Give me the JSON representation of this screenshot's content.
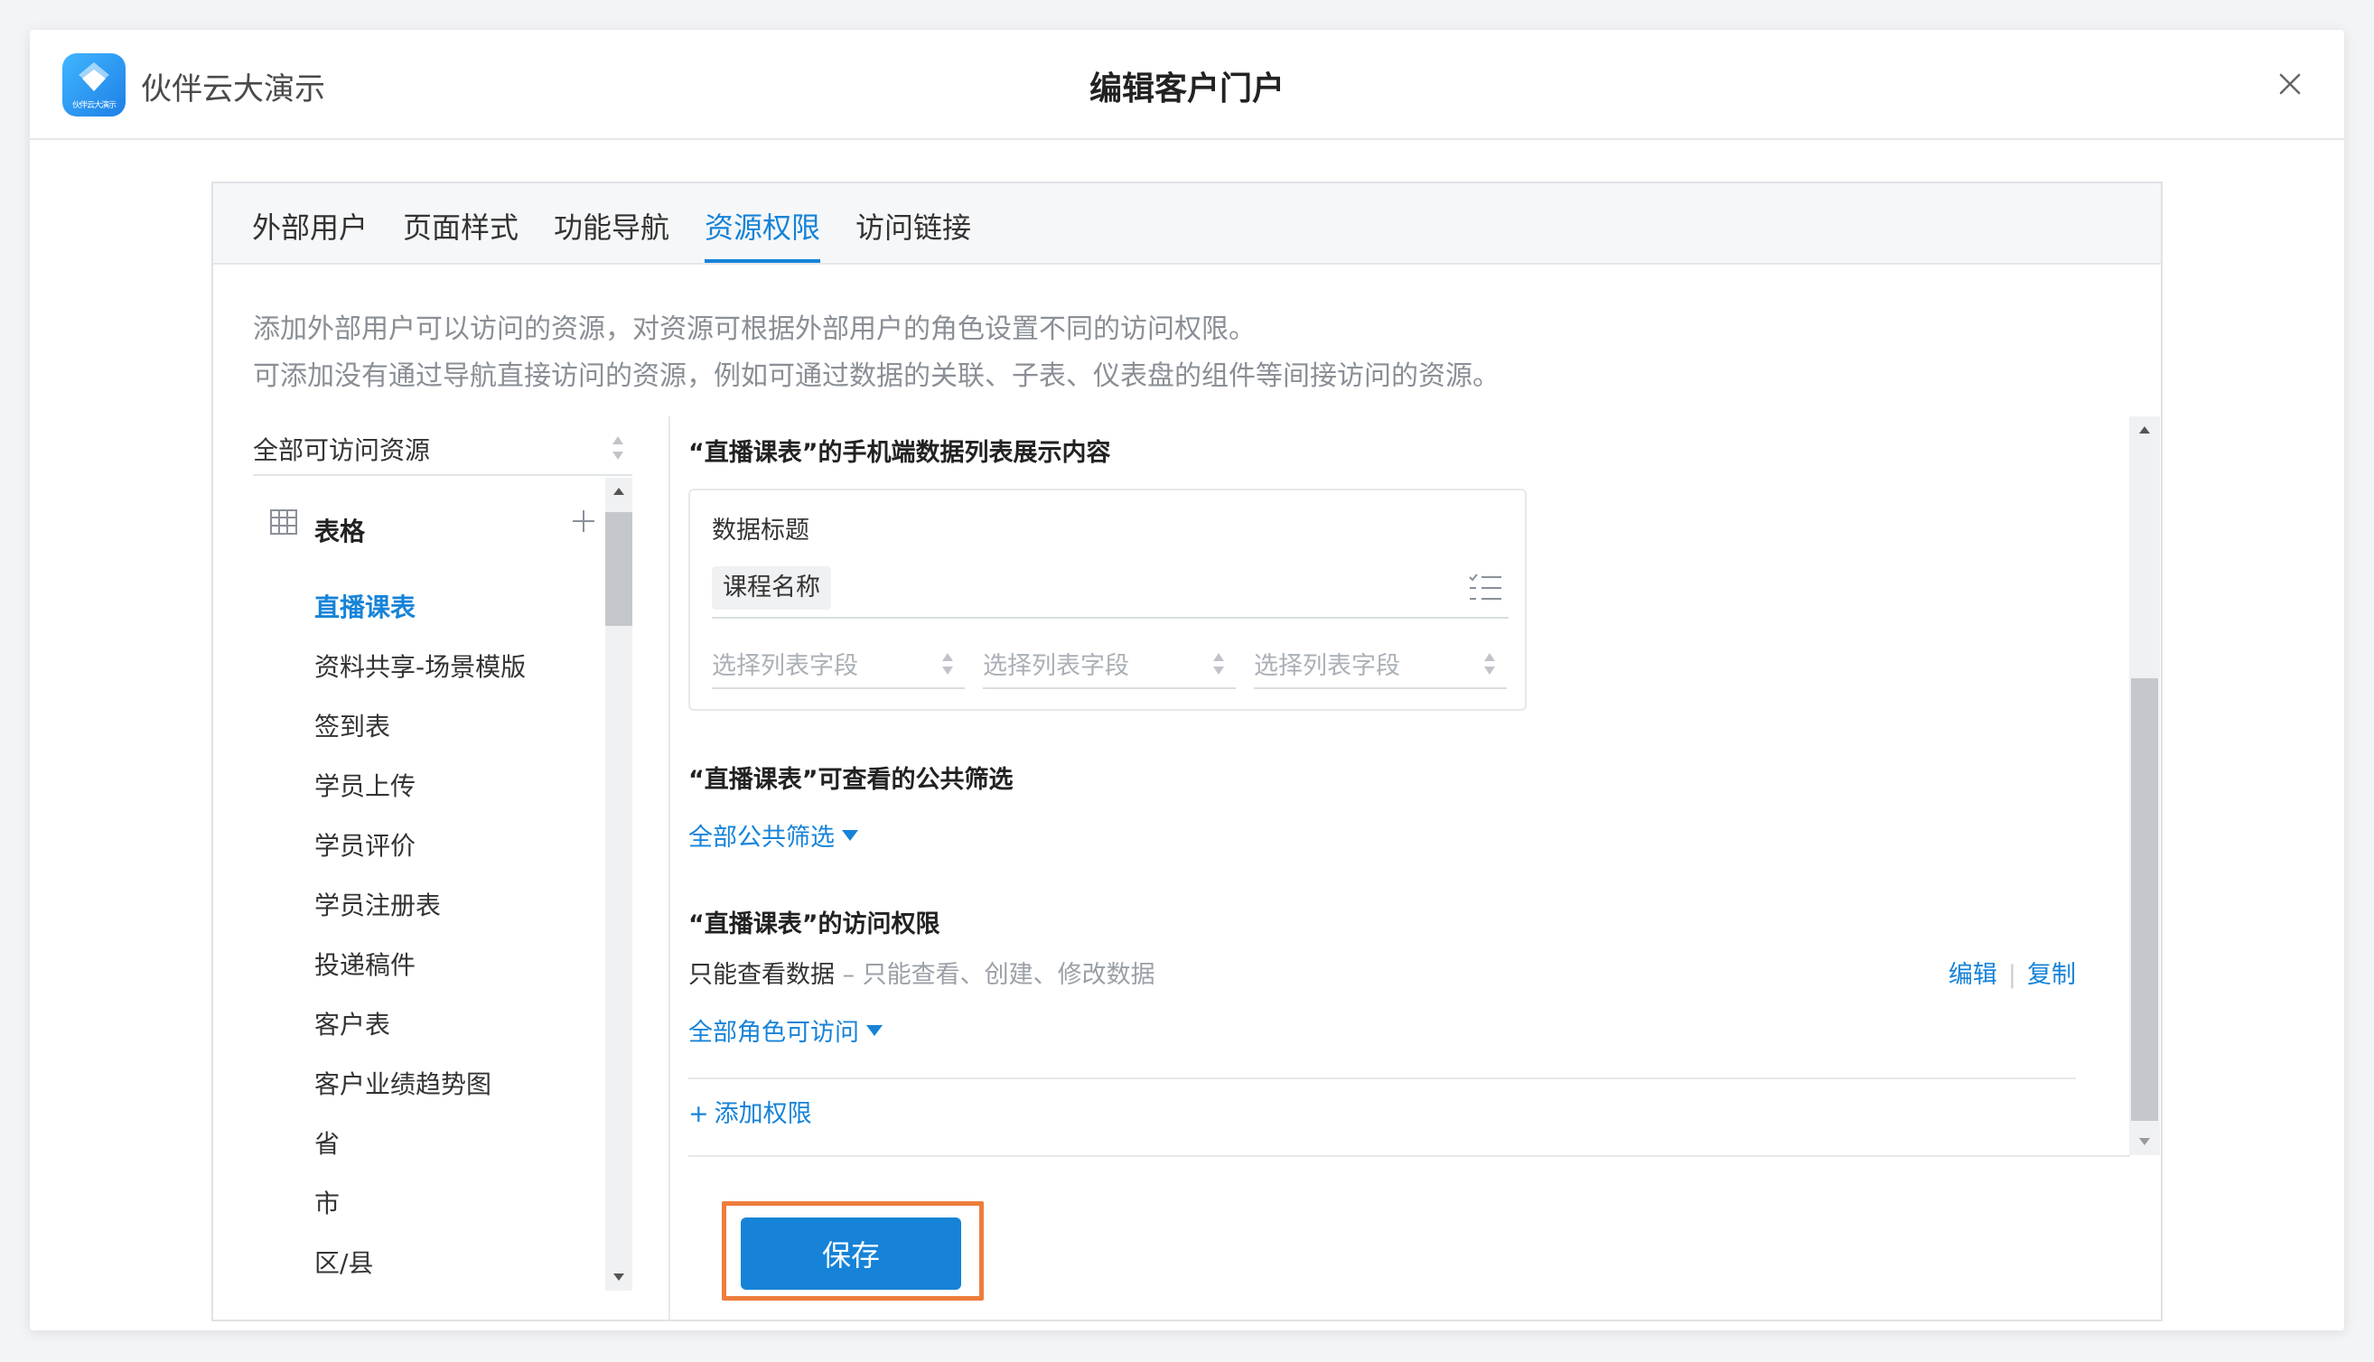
{
  "app": {
    "name": "伙伴云大演示",
    "logo_text": "伙伴云大演示"
  },
  "dialog": {
    "title": "编辑客户门户",
    "close_icon": "close-icon"
  },
  "tabs": [
    {
      "label": "外部用户"
    },
    {
      "label": "页面样式"
    },
    {
      "label": "功能导航"
    },
    {
      "label": "资源权限",
      "active": true
    },
    {
      "label": "访问链接"
    }
  ],
  "description": {
    "line1": "添加外部用户可以访问的资源，对资源可根据外部用户的角色设置不同的访问权限。",
    "line2": "可添加没有通过导航直接访问的资源，例如可通过数据的关联、子表、仪表盘的组件等间接访问的资源。"
  },
  "resource_filter": {
    "value": "全部可访问资源"
  },
  "tree": {
    "group_label": "表格",
    "items": [
      {
        "label": "直播课表",
        "active": true
      },
      {
        "label": "资料共享-场景模版"
      },
      {
        "label": "签到表"
      },
      {
        "label": "学员上传"
      },
      {
        "label": "学员评价"
      },
      {
        "label": "学员注册表"
      },
      {
        "label": "投递稿件"
      },
      {
        "label": "客户表"
      },
      {
        "label": "客户业绩趋势图"
      },
      {
        "label": "省"
      },
      {
        "label": "市"
      },
      {
        "label": "区/县"
      }
    ]
  },
  "mobile_display": {
    "title": "“直播课表”的手机端数据列表展示内容",
    "data_title_label": "数据标题",
    "title_chip": "课程名称",
    "field_placeholders": [
      "选择列表字段",
      "选择列表字段",
      "选择列表字段"
    ]
  },
  "public_filter": {
    "title": "“直播课表”可查看的公共筛选",
    "link": "全部公共筛选"
  },
  "access": {
    "title": "“直播课表”的访问权限",
    "permission_main": "只能查看数据",
    "permission_sub": " – 只能查看、创建、修改数据",
    "edit_label": "编辑",
    "copy_label": "复制",
    "separator": "|",
    "roles_link": "全部角色可访问",
    "add_label": "添加权限",
    "add_prefix": "+"
  },
  "save_label": "保存",
  "colors": {
    "accent": "#1683d8",
    "highlight": "#ee7d3b"
  }
}
